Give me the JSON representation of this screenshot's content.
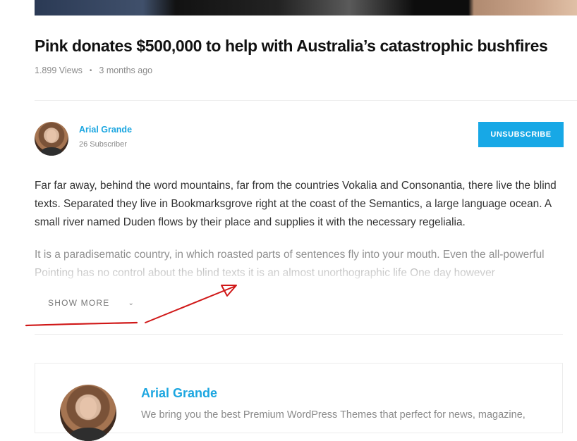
{
  "article": {
    "title": "Pink donates $500,000 to help with Australia’s catastrophic bushfires",
    "views": "1.899 Views",
    "separator": "•",
    "time_ago": "3 months ago"
  },
  "author": {
    "name": "Arial Grande",
    "subscribers": "26 Subscriber",
    "unsubscribe_label": "UNSUBSCRIBE"
  },
  "body": {
    "paragraph1": "Far far away, behind the word mountains, far from the countries Vokalia and Consonantia, there live the blind texts. Separated they live in Bookmarksgrove right at the coast of the Semantics, a large language ocean. A small river named Duden flows by their place and supplies it with the necessary regelialia.",
    "paragraph2": "It is a paradisematic country, in which roasted parts of sentences fly into your mouth. Even the all-powerful Pointing has no control about the blind texts it is an almost unorthographic life One day however",
    "show_more_label": "SHOW MORE",
    "show_more_icon": "chevron-down-icon"
  },
  "author_box": {
    "name": "Arial Grande",
    "bio": "We bring you the best Premium WordPress Themes that perfect for news, magazine,"
  },
  "colors": {
    "accent": "#17a8e6",
    "annotation": "#d01818"
  }
}
